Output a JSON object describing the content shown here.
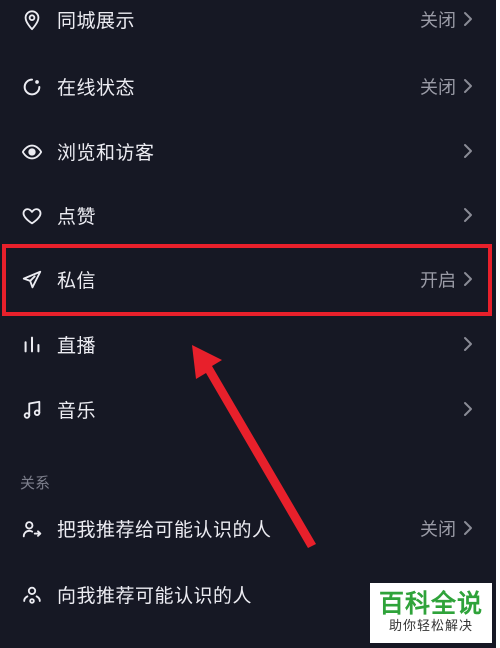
{
  "settings": {
    "items": [
      {
        "label": "同城展示",
        "value": "关闭",
        "icon": "location-pin-icon"
      },
      {
        "label": "在线状态",
        "value": "关闭",
        "icon": "online-status-icon"
      },
      {
        "label": "浏览和访客",
        "value": "",
        "icon": "eye-icon"
      },
      {
        "label": "点赞",
        "value": "",
        "icon": "heart-icon"
      },
      {
        "label": "私信",
        "value": "开启",
        "icon": "paper-plane-icon"
      },
      {
        "label": "直播",
        "value": "",
        "icon": "live-bars-icon"
      },
      {
        "label": "音乐",
        "value": "",
        "icon": "music-note-icon"
      }
    ],
    "relations_header": "关系",
    "relations": [
      {
        "label": "把我推荐给可能认识的人",
        "value": "关闭",
        "icon": "user-share-icon"
      },
      {
        "label": "向我推荐可能认识的人",
        "value": "",
        "icon": "user-recommend-icon"
      }
    ]
  },
  "annotation": {
    "highlight_color": "#e8202b",
    "highlighted_item": "私信"
  },
  "watermark": {
    "title": "百科全说",
    "subtitle": "助你轻松解决"
  },
  "colors": {
    "background": "#161824",
    "text": "#ececf2",
    "secondary_text": "#9a9ba6",
    "watermark_green": "#2fa33a"
  }
}
